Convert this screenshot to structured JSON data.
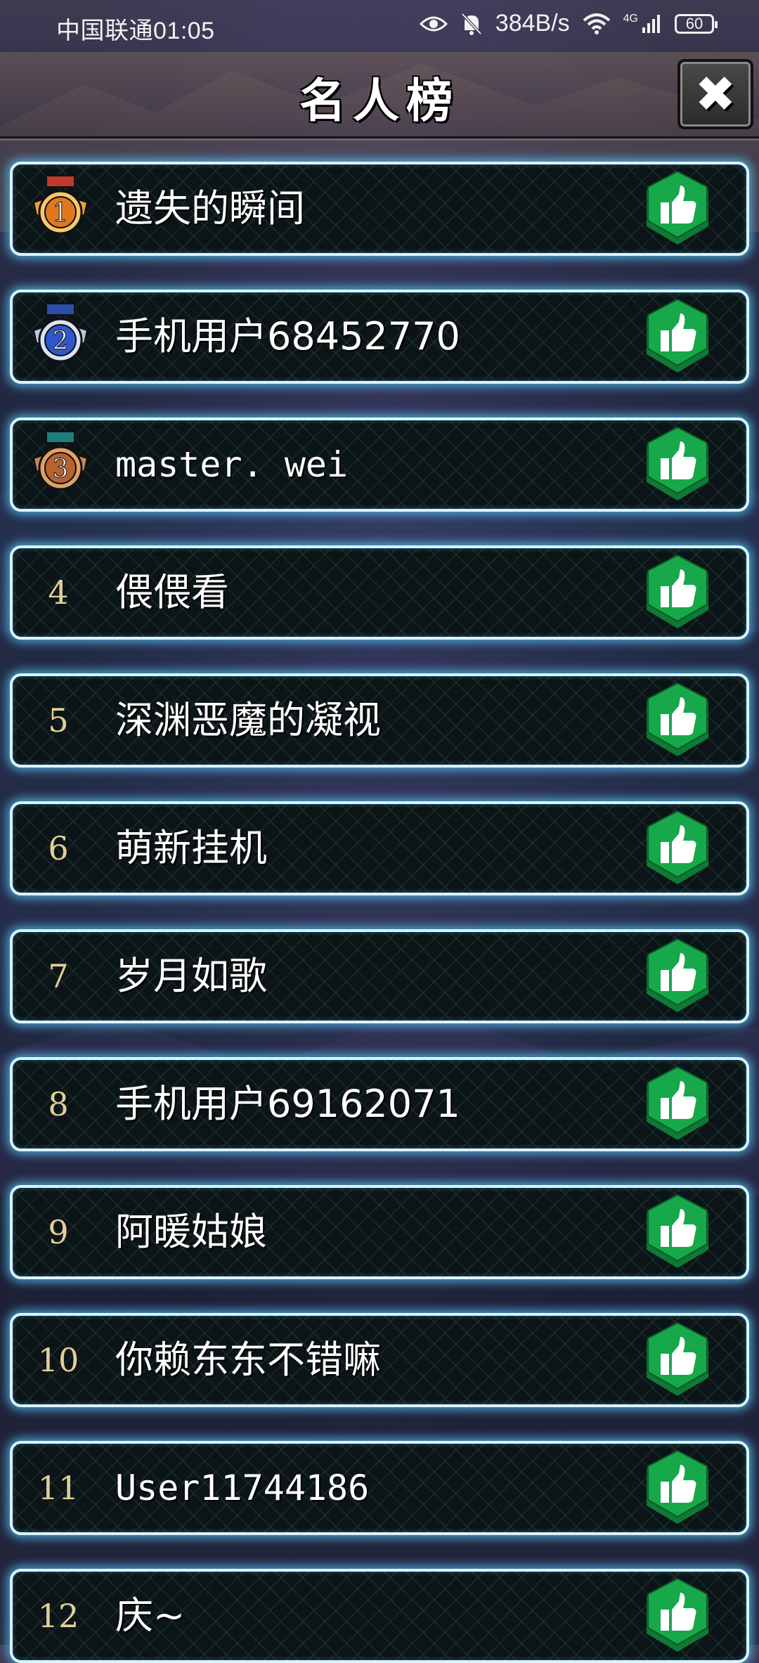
{
  "status_bar": {
    "carrier_time": "中国联通01:05",
    "net_speed": "384B/s",
    "network": "4G",
    "battery": "60",
    "icons": [
      "eye-icon",
      "bell-off-icon",
      "wifi-icon",
      "signal-icon",
      "battery-icon"
    ]
  },
  "header": {
    "title": "名人榜",
    "close_icon": "✖"
  },
  "colors": {
    "row_border": "#d7f4ff",
    "row_glow": "#5ac8ff",
    "like_green": "#17a84a",
    "rank_text": "#e4cf9a"
  },
  "leaderboard": [
    {
      "rank": "1",
      "name": "遗失的瞬间",
      "medal": "gold"
    },
    {
      "rank": "2",
      "name": "手机用户68452770",
      "medal": "silver"
    },
    {
      "rank": "3",
      "name": "master. wei",
      "medal": "bronze"
    },
    {
      "rank": "4",
      "name": "偎偎看"
    },
    {
      "rank": "5",
      "name": "深渊恶魔的凝视"
    },
    {
      "rank": "6",
      "name": "萌新挂机"
    },
    {
      "rank": "7",
      "name": "岁月如歌"
    },
    {
      "rank": "8",
      "name": "手机用户69162071"
    },
    {
      "rank": "9",
      "name": "阿暖姑娘"
    },
    {
      "rank": "10",
      "name": "你赖东东不错嘛"
    },
    {
      "rank": "11",
      "name": "User11744186"
    },
    {
      "rank": "12",
      "name": "庆~"
    }
  ]
}
